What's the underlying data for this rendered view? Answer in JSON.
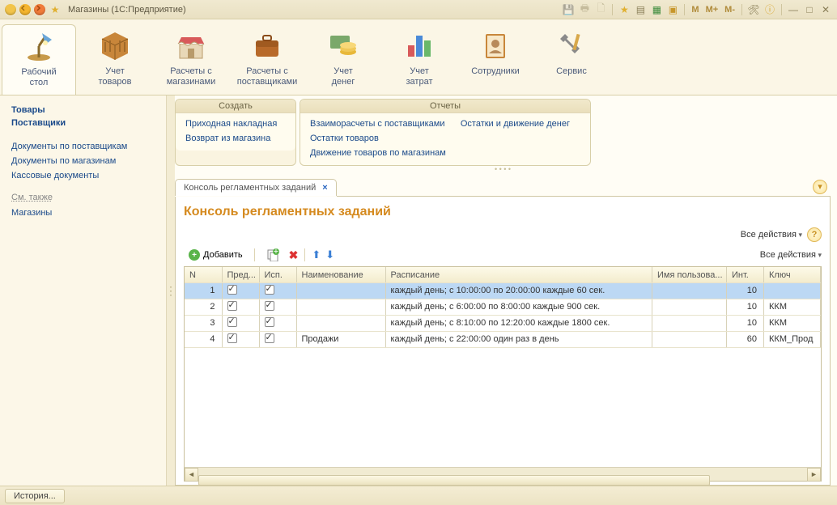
{
  "window": {
    "title": "Магазины  (1С:Предприятие)"
  },
  "ribbon": [
    {
      "label": "Рабочий\nстол"
    },
    {
      "label": "Учет\nтоваров"
    },
    {
      "label": "Расчеты с\nмагазинами"
    },
    {
      "label": "Расчеты с\nпоставщиками"
    },
    {
      "label": "Учет\nденег"
    },
    {
      "label": "Учет\nзатрат"
    },
    {
      "label": "Сотрудники"
    },
    {
      "label": "Сервис"
    }
  ],
  "sidebar": {
    "primary": [
      "Товары",
      "Поставщики"
    ],
    "docs": [
      "Документы по поставщикам",
      "Документы по магазинам",
      "Кассовые документы"
    ],
    "see_also_hdr": "См. также",
    "see_also": [
      "Магазины"
    ]
  },
  "create_panel": {
    "title": "Создать",
    "items": [
      "Приходная накладная",
      "Возврат из магазина"
    ]
  },
  "reports_panel": {
    "title": "Отчеты",
    "col1": [
      "Взаиморасчеты с поставщиками",
      "Остатки товаров",
      "Движение товаров по магазинам"
    ],
    "col2": [
      "Остатки и движение денег"
    ]
  },
  "tab": {
    "label": "Консоль регламентных заданий"
  },
  "page": {
    "title": "Консоль регламентных заданий",
    "all_actions": "Все действия",
    "add_label": "Добавить"
  },
  "table": {
    "cols": [
      "N",
      "Пред...",
      "Исп.",
      "Наименование",
      "Расписание",
      "Имя пользова...",
      "Инт.",
      "Ключ"
    ],
    "rows": [
      {
        "n": 1,
        "pred": true,
        "isp": true,
        "name": "",
        "sched": "каждый  день; с 10:00:00 по 20:00:00 каждые 60 сек.",
        "user": "",
        "int": 10,
        "key": ""
      },
      {
        "n": 2,
        "pred": true,
        "isp": true,
        "name": "",
        "sched": "каждый  день; с 6:00:00 по 8:00:00 каждые 900 сек.",
        "user": "",
        "int": 10,
        "key": "ККМ"
      },
      {
        "n": 3,
        "pred": true,
        "isp": true,
        "name": "",
        "sched": "каждый  день; с 8:10:00 по 12:20:00 каждые 1800 сек.",
        "user": "",
        "int": 10,
        "key": "ККМ"
      },
      {
        "n": 4,
        "pred": true,
        "isp": true,
        "name": "Продажи",
        "sched": "каждый  день; с 22:00:00 один раз в день",
        "user": "",
        "int": 60,
        "key": "ККМ_Прод"
      }
    ]
  },
  "status": {
    "history": "История..."
  },
  "colors": {
    "accent": "#d58a1f",
    "link": "#1b4a8a"
  }
}
